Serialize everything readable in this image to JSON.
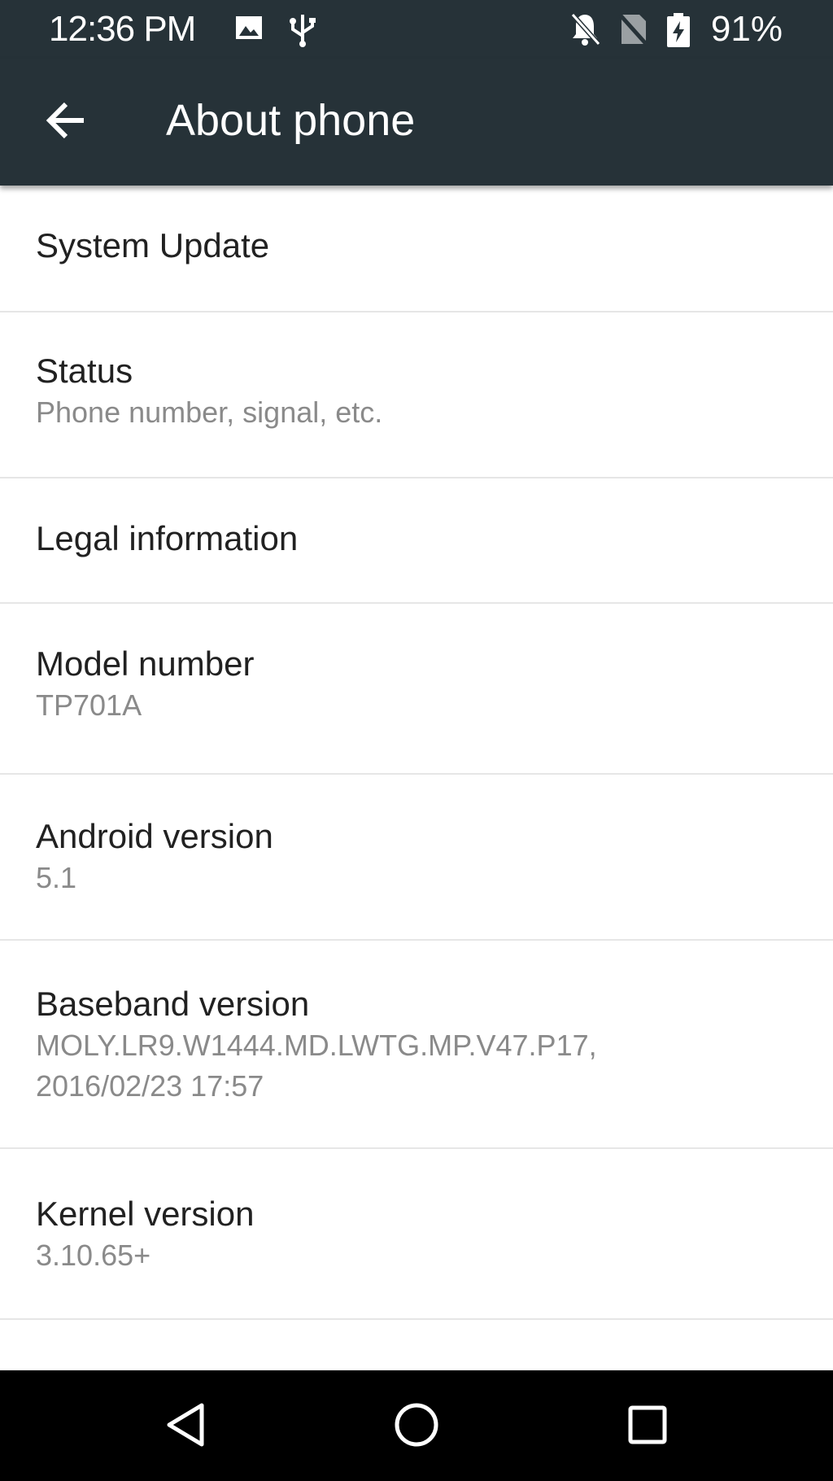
{
  "status_bar": {
    "time": "12:36 PM",
    "battery": "91%",
    "icons": [
      "image-icon",
      "usb-icon",
      "notifications-off-icon",
      "no-sim-icon",
      "battery-charging-icon"
    ]
  },
  "toolbar": {
    "back_icon": "arrow-back-icon",
    "title": "About phone"
  },
  "items": [
    {
      "title": "System Update",
      "summary": ""
    },
    {
      "title": "Status",
      "summary": "Phone number, signal, etc."
    },
    {
      "title": "Legal information",
      "summary": ""
    },
    {
      "title": "Model number",
      "summary": "TP701A"
    },
    {
      "title": "Android version",
      "summary": "5.1"
    },
    {
      "title": "Baseband version",
      "summary": "MOLY.LR9.W1444.MD.LWTG.MP.V47.P17,",
      "summary_line2": "2016/02/23 17:57"
    },
    {
      "title": "Kernel version",
      "summary": "3.10.65+"
    }
  ],
  "nav_bar": {
    "icons": [
      "back-triangle-icon",
      "home-circle-icon",
      "recents-square-icon"
    ]
  },
  "colors": {
    "toolbar_bg": "#263238",
    "nav_bg": "#000000",
    "title_text": "#212121",
    "summary_text": "#8a8a8a"
  }
}
